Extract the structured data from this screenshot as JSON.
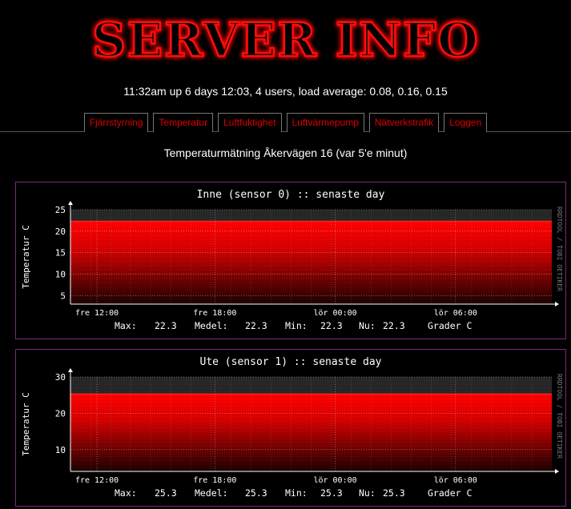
{
  "header": {
    "logo_text": "SERVER INFO",
    "uptime": "11:32am up 6 days 12:03, 4 users, load average: 0.08, 0.16, 0.15"
  },
  "nav": {
    "items": [
      {
        "label": "Fjärrstyrning"
      },
      {
        "label": "Temperatur"
      },
      {
        "label": "Luftfuktighet"
      },
      {
        "label": "Luftvärmepump"
      },
      {
        "label": "Nätverkstrafik"
      },
      {
        "label": "Loggen"
      }
    ]
  },
  "page": {
    "subtitle": "Temperaturmätning Åkervägen 16 (var 5'e minut)"
  },
  "colors": {
    "accent": "#e00000",
    "graph_border": "#7a2a7a",
    "plot_bg": "#262626"
  },
  "graphs": [
    {
      "title": "Inne (sensor 0) :: senaste day",
      "ylabel": "Temperatur C",
      "watermark": "RRDTOOL / TOBI OETIKER",
      "stats": {
        "max_label": "Max:",
        "max": "22.3",
        "avg_label": "Medel:",
        "avg": "22.3",
        "min_label": "Min:",
        "min": "22.3",
        "now_label": "Nu:",
        "now": "22.3",
        "unit": "Grader C"
      },
      "chart_data": {
        "type": "area",
        "x_tick_labels": [
          "fre 12:00",
          "fre 18:00",
          "lör 00:00",
          "lör 06:00"
        ],
        "y_ticks": [
          5,
          10,
          15,
          20,
          25
        ],
        "ylim": [
          3,
          25
        ],
        "series": [
          {
            "values": [
              22.3,
              22.3
            ]
          }
        ],
        "grid": true
      }
    },
    {
      "title": "Ute (sensor 1) :: senaste day",
      "ylabel": "Temperatur C",
      "watermark": "RRDTOOL / TOBI OETIKER",
      "stats": {
        "max_label": "Max:",
        "max": "25.3",
        "avg_label": "Medel:",
        "avg": "25.3",
        "min_label": "Min:",
        "min": "25.3",
        "now_label": "Nu:",
        "now": "25.3",
        "unit": "Grader C"
      },
      "chart_data": {
        "type": "area",
        "x_tick_labels": [
          "fre 12:00",
          "fre 18:00",
          "lör 00:00",
          "lör 06:00"
        ],
        "y_ticks": [
          10,
          20,
          30
        ],
        "ylim": [
          4,
          30
        ],
        "series": [
          {
            "values": [
              25.3,
              25.3
            ]
          }
        ],
        "grid": true
      }
    }
  ]
}
